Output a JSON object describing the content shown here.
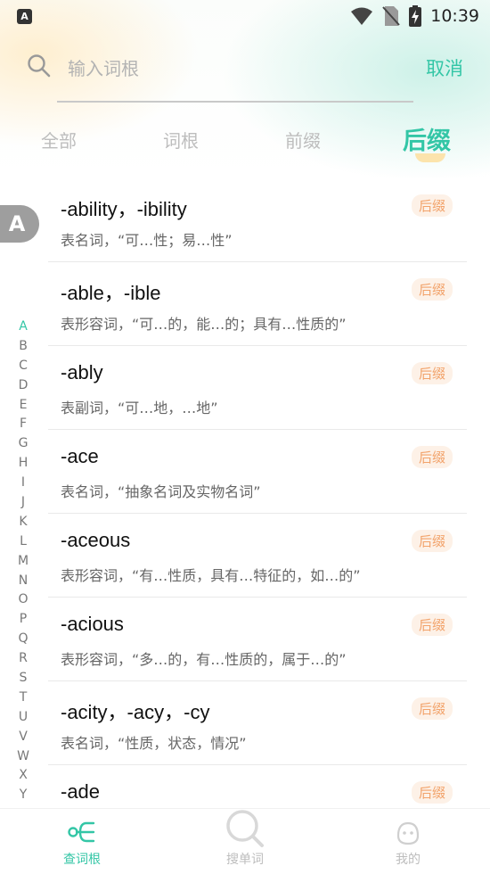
{
  "status_bar": {
    "time": "10:39",
    "app_badge": "A"
  },
  "search": {
    "placeholder": "输入词根",
    "cancel_label": "取消"
  },
  "tabs": [
    {
      "label": "全部"
    },
    {
      "label": "词根"
    },
    {
      "label": "前缀"
    },
    {
      "label": "后缀",
      "active": true
    }
  ],
  "current_letter": "A",
  "items": [
    {
      "word": "-ability，-ibility",
      "desc": "表名词，“可…性；易…性”",
      "tag": "后缀"
    },
    {
      "word": "-able，-ible",
      "desc": "表形容词，“可…的，能…的；具有…性质的”",
      "tag": "后缀"
    },
    {
      "word": "-ably",
      "desc": "表副词，“可…地，…地”",
      "tag": "后缀"
    },
    {
      "word": "-ace",
      "desc": "表名词，“抽象名词及实物名词”",
      "tag": "后缀"
    },
    {
      "word": "-aceous",
      "desc": "表形容词，“有…性质，具有…特征的，如…的”",
      "tag": "后缀"
    },
    {
      "word": "-acious",
      "desc": "表形容词，“多…的，有…性质的，属于…的”",
      "tag": "后缀"
    },
    {
      "word": "-acity，-acy，-cy",
      "desc": "表名词，“性质，状态，情况”",
      "tag": "后缀"
    },
    {
      "word": "-ade",
      "desc": "",
      "tag": "后缀"
    }
  ],
  "alphabet": [
    "A",
    "B",
    "C",
    "D",
    "E",
    "F",
    "G",
    "H",
    "I",
    "J",
    "K",
    "L",
    "M",
    "N",
    "O",
    "P",
    "Q",
    "R",
    "S",
    "T",
    "U",
    "V",
    "W",
    "X",
    "Y"
  ],
  "bottom_nav": [
    {
      "label": "查词根",
      "icon": "tree-icon",
      "active": true
    },
    {
      "label": "搜单词",
      "icon": "search-icon",
      "active": false
    },
    {
      "label": "我的",
      "icon": "face-icon",
      "active": false
    }
  ],
  "colors": {
    "accent": "#33c6a6",
    "tag_text": "#f2a36b",
    "tag_bg": "#fdf1e7",
    "inactive": "#bdbdbd"
  }
}
